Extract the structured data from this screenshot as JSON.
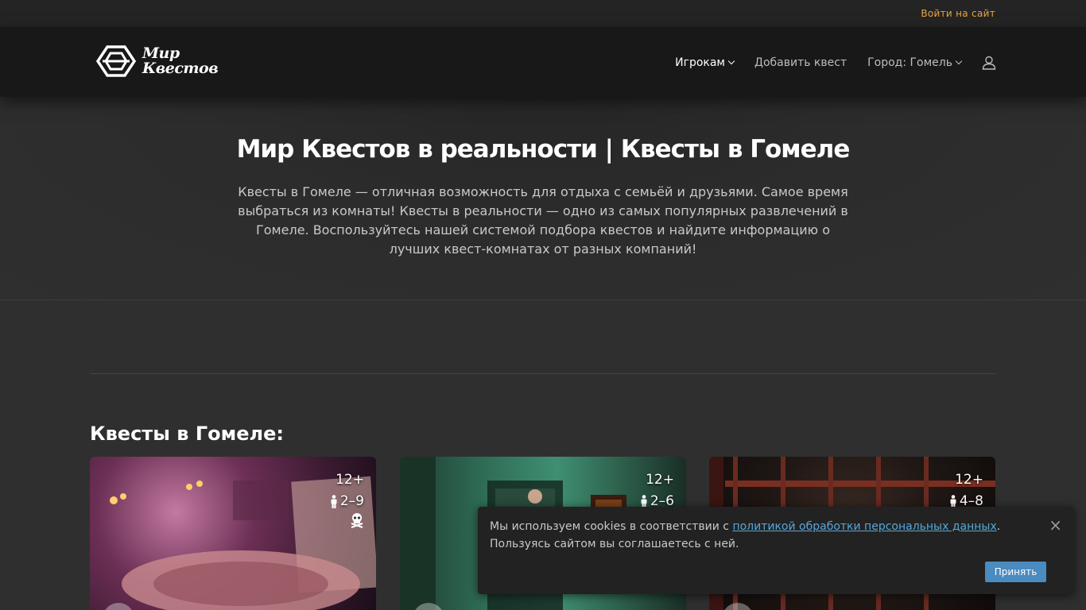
{
  "topbar": {
    "login": "Войти на сайт"
  },
  "logo": {
    "line1": "Мир",
    "line2": "Квестов"
  },
  "nav": {
    "players": "Игрокам",
    "add_quest": "Добавить квест",
    "city": "Город: Гомель"
  },
  "hero": {
    "title": "Мир Квестов в реальности | Квесты в Гомеле",
    "description": "Квесты в Гомеле — отличная возможность для отдыха с семьёй и друзьями. Самое время выбраться из комнаты! Квесты в реальности — одно из самых популярных развлечений в Гомеле. Воспользуйтесь нашей системой подбора квестов и найдите информацию о лучших квест-комнатах от разных компаний!"
  },
  "section": {
    "title": "Квесты в Гомеле:"
  },
  "cards": [
    {
      "age": "12+",
      "players": "2–9",
      "icon": "skull-icon"
    },
    {
      "age": "12+",
      "players": "2–6"
    },
    {
      "age": "12+",
      "players": "4–8"
    }
  ],
  "cookie": {
    "text_before": "Мы используем cookies в соответствии с ",
    "link": "политикой обработки персональных данных",
    "text_after": ". Пользуясь сайтом вы соглашаетесь с ней.",
    "accept": "Принять",
    "close": "×"
  },
  "colors": {
    "accent": "#e8a545",
    "link": "#5aa6d6",
    "button": "#4a8bc0"
  }
}
